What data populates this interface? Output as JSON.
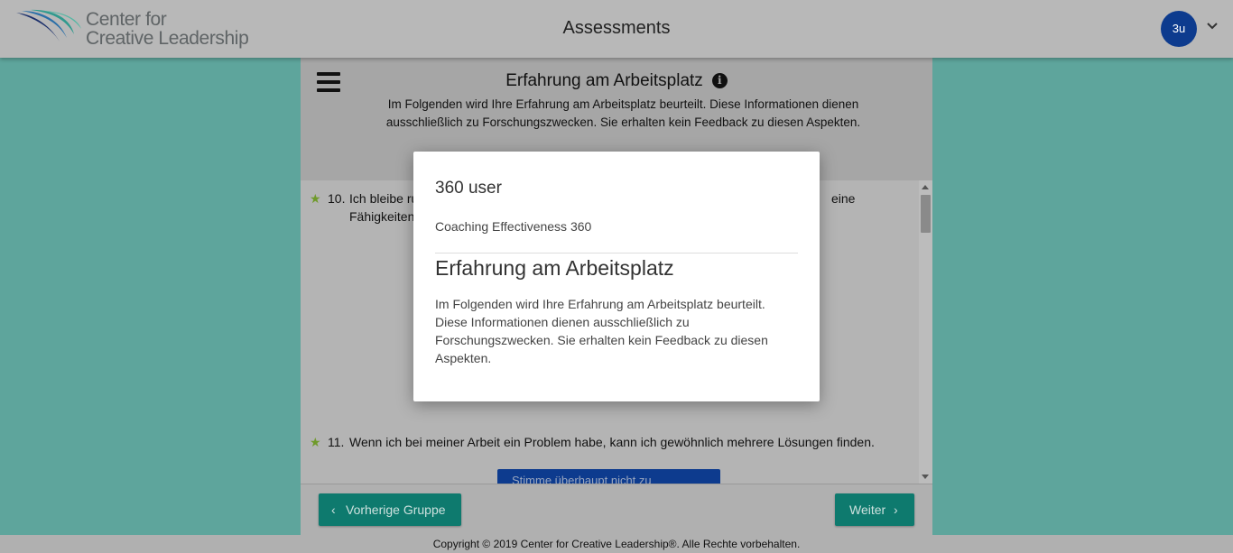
{
  "header": {
    "logo_line1": "Center for",
    "logo_line2": "Creative Leadership",
    "title": "Assessments",
    "avatar_initials": "3u",
    "menu_icon": "chevron-down-icon"
  },
  "section": {
    "title": "Erfahrung am Arbeitsplatz",
    "info_icon_glyph": "i",
    "description": "Im Folgenden wird Ihre Erfahrung am Arbeitsplatz beurteilt. Diese Informationen dienen ausschließlich zu Forschungszwecken. Sie erhalten kein Feedback zu diesen Aspekten."
  },
  "questions": [
    {
      "number": "10.",
      "text": "Ich bleibe ru",
      "text_tail": "eine",
      "line2": "Fähigkeiten"
    },
    {
      "number": "11.",
      "text": "Wenn ich bei meiner Arbeit ein Problem habe, kann ich gewöhnlich mehrere Lösungen finden.",
      "answer_label": "Stimme überhaupt nicht zu"
    }
  ],
  "navigation": {
    "prev_label": "Vorherige Gruppe",
    "next_label": "Weiter"
  },
  "footer": {
    "copyright": "Copyright © 2019 Center for Creative Leadership®. Alle Rechte vorbehalten."
  },
  "modal": {
    "user": "360 user",
    "assessment": "Coaching Effectiveness 360",
    "title": "Erfahrung am Arbeitsplatz",
    "text": "Im Folgenden wird Ihre Erfahrung am Arbeitsplatz beurteilt. Diese Informationen dienen ausschließlich zu Forschungszwecken. Sie erhalten kein Feedback zu diesen Aspekten."
  },
  "colors": {
    "background": "#5ea59c",
    "primary_button": "#0e7a6e",
    "answer_button": "#0d3b8e",
    "star": "#6f9a2a"
  }
}
